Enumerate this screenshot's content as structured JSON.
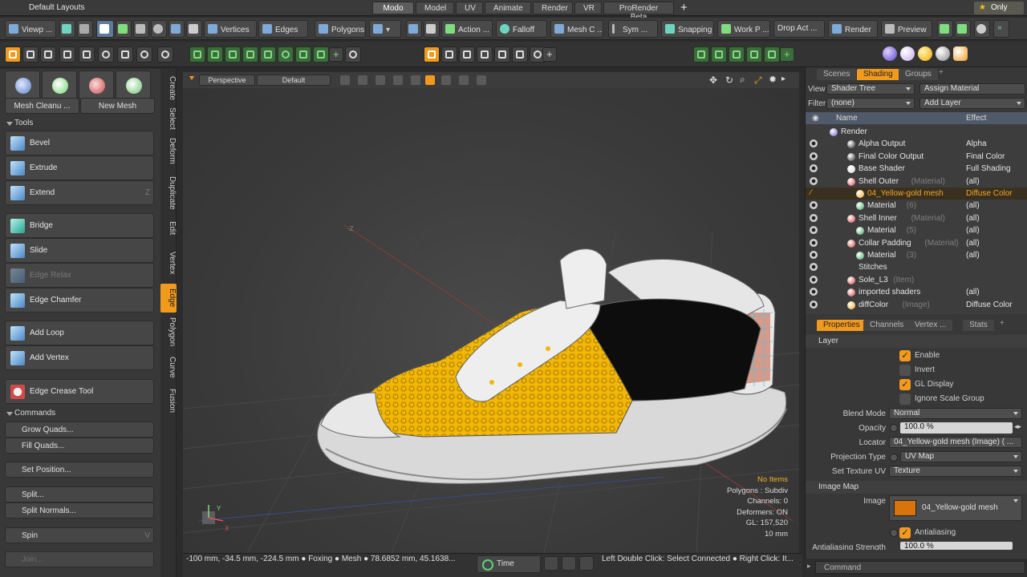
{
  "titlebar": {
    "layout_name": "Default Layouts",
    "tabs": [
      "Modo",
      "Model",
      "UV",
      "Animate",
      "Render",
      "VR",
      "ProRender Beta"
    ],
    "active_tab": "Modo",
    "add_tab": "+",
    "only_label": "Only"
  },
  "toolbar1": {
    "viewport_label": "Viewp ...",
    "vertices": "Vertices",
    "edges": "Edges",
    "polygons": "Polygons",
    "action": "Action ...",
    "falloff": "Falloff",
    "mesh_c": "Mesh C ...",
    "sym": "Sym ...",
    "snapping": "Snapping",
    "work_p": "Work P ...",
    "drop_act": "Drop Act ...",
    "render": "Render",
    "preview": "Preview"
  },
  "left": {
    "mesh_cleanup": "Mesh Cleanu ...",
    "new_mesh": "New Mesh",
    "tools_header": "Tools",
    "tools": [
      {
        "label": "Bevel",
        "key": ""
      },
      {
        "label": "Extrude",
        "key": ""
      },
      {
        "label": "Extend",
        "key": "Z"
      },
      {
        "label": "Bridge",
        "key": ""
      },
      {
        "label": "Slide",
        "key": ""
      },
      {
        "label": "Edge Relax",
        "key": ""
      },
      {
        "label": "Edge Chamfer",
        "key": ""
      },
      {
        "label": "Add Loop",
        "key": ""
      },
      {
        "label": "Add Vertex",
        "key": ""
      },
      {
        "label": "Edge Crease Tool",
        "key": ""
      }
    ],
    "commands_header": "Commands",
    "commands": [
      {
        "label": "Grow Quads...",
        "key": ""
      },
      {
        "label": "Fill Quads...",
        "key": ""
      },
      {
        "label": "Set Position...",
        "key": ""
      },
      {
        "label": "Split...",
        "key": ""
      },
      {
        "label": "Split Normals...",
        "key": ""
      },
      {
        "label": "Spin",
        "key": "V"
      },
      {
        "label": "Join...",
        "key": ""
      }
    ]
  },
  "vtabs": [
    "Create",
    "Select",
    "Deform",
    "Duplicate",
    "Edit",
    "Vertex",
    "Edge",
    "Polygon",
    "Curve",
    "Fusion"
  ],
  "vtabs_active": "Edge",
  "viewport": {
    "view_mode": "Perspective",
    "shading": "Default",
    "axis_label": "-Z",
    "gizmo_y": "Y",
    "gizmo_x": "X",
    "info": {
      "items": "No Items",
      "polygons": "Polygons : Subdiv",
      "channels": "Channels: 0",
      "deformers": "Deformers: ON",
      "gl": "GL: 157,520",
      "scale": "10 mm"
    }
  },
  "statusbar": {
    "coords": "-100 mm, -34.5 mm, -224.5 mm",
    "foxing": "Foxing",
    "mesh": "Mesh",
    "mesh_vals": "78.6852 mm, 45.1638...",
    "time": "Time",
    "hint": "Left Double Click: Select Connected ● Right Click: It..."
  },
  "right": {
    "top_tabs": [
      "Scenes",
      "Shading",
      "Groups"
    ],
    "active_top_tab": "Shading",
    "view_label": "View",
    "view_value": "Shader Tree",
    "assign_material": "Assign Material",
    "filter_label": "Filter",
    "filter_value": "(none)",
    "add_layer": "Add Layer",
    "col_name": "Name",
    "col_effect": "Effect",
    "tree": [
      {
        "name": "Render",
        "sub": "",
        "effect": "",
        "indent": 0,
        "dot": "#6b5bd6",
        "sel": false,
        "eye": false
      },
      {
        "name": "Alpha Output",
        "sub": "",
        "effect": "Alpha",
        "indent": 2,
        "dot": "#2d2d2d",
        "sel": false,
        "eye": true
      },
      {
        "name": "Final Color Output",
        "sub": "",
        "effect": "Final Color",
        "indent": 2,
        "dot": "#2d2d2d",
        "sel": false,
        "eye": true
      },
      {
        "name": "Base Shader",
        "sub": "",
        "effect": "Full Shading",
        "indent": 2,
        "dot": "#d8d8d8",
        "sel": false,
        "eye": true
      },
      {
        "name": "Shell Outer",
        "sub": "(Material)",
        "effect": "(all)",
        "indent": 2,
        "dot": "#d43b3b",
        "sel": false,
        "eye": true
      },
      {
        "name": "04_Yellow-gold mesh",
        "sub": "",
        "effect": "Diffuse Color",
        "indent": 3,
        "dot": "#f5a623",
        "sel": true,
        "eye": false
      },
      {
        "name": "Material",
        "sub": "(6)",
        "effect": "(all)",
        "indent": 3,
        "dot": "#3aa35a",
        "sel": false,
        "eye": true
      },
      {
        "name": "Shell Inner",
        "sub": "(Material)",
        "effect": "(all)",
        "indent": 2,
        "dot": "#d43b3b",
        "sel": false,
        "eye": true
      },
      {
        "name": "Material",
        "sub": "(5)",
        "effect": "(all)",
        "indent": 3,
        "dot": "#3aa35a",
        "sel": false,
        "eye": true
      },
      {
        "name": "Collar Padding",
        "sub": "(Material)",
        "effect": "(all)",
        "indent": 2,
        "dot": "#d43b3b",
        "sel": false,
        "eye": true
      },
      {
        "name": "Material",
        "sub": "(3)",
        "effect": "(all)",
        "indent": 3,
        "dot": "#3aa35a",
        "sel": false,
        "eye": true
      },
      {
        "name": "Stitches",
        "sub": "",
        "effect": "",
        "indent": 2,
        "dot": "",
        "sel": false,
        "eye": true
      },
      {
        "name": "Sole_L3",
        "sub": "(Item)",
        "effect": "",
        "indent": 2,
        "dot": "#d43b3b",
        "sel": false,
        "eye": true
      },
      {
        "name": "imported shaders",
        "sub": "",
        "effect": "(all)",
        "indent": 2,
        "dot": "#d43b3b",
        "sel": false,
        "eye": true
      },
      {
        "name": "diffColor",
        "sub": "(Image)",
        "effect": "Diffuse Color",
        "indent": 2,
        "dot": "#f5a623",
        "sel": false,
        "eye": true
      }
    ],
    "prop_tabs": [
      "Properties",
      "Channels",
      "Vertex ...",
      "Stats"
    ],
    "active_prop_tab": "Properties",
    "layer_header": "Layer",
    "enable": "Enable",
    "invert": "Invert",
    "gl_display": "GL Display",
    "ignore_scale": "Ignore Scale Group",
    "blend_mode_label": "Blend Mode",
    "blend_mode": "Normal",
    "opacity_label": "Opacity",
    "opacity": "100.0 %",
    "locator_label": "Locator",
    "locator": "04_Yellow-gold mesh (Image) ( ...",
    "projection_label": "Projection Type",
    "projection": "UV Map",
    "settex_label": "Set Texture UV",
    "settex": "Texture",
    "imagemap_header": "Image Map",
    "image_label": "Image",
    "image_value": "04_Yellow-gold mesh",
    "antialiasing": "Antialiasing",
    "aa_strength_label": "Antialiasing Strength",
    "aa_strength": "100.0 %",
    "command_placeholder": "Command"
  },
  "colors": {
    "accent": "#f19a1e",
    "shoe_yellow": "#f2b705",
    "shoe_black": "#0d0d0d"
  }
}
